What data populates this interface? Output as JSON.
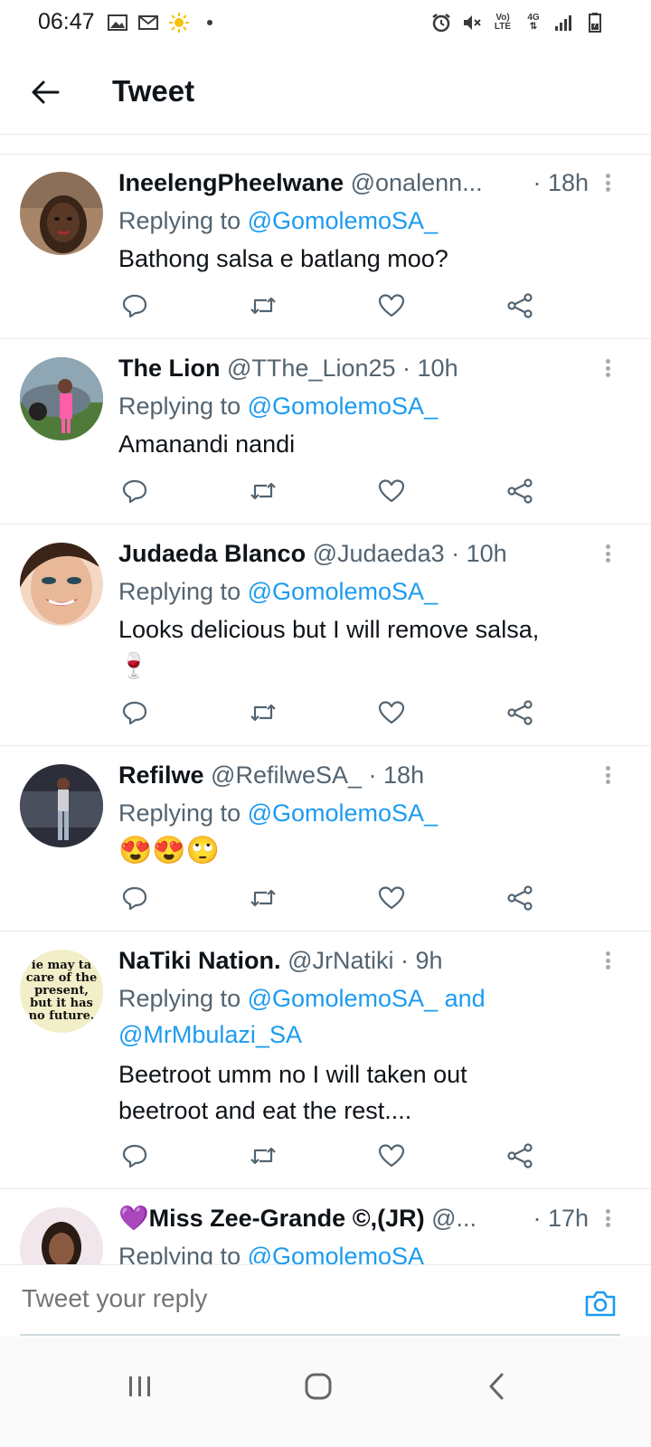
{
  "status_bar": {
    "time": "06:47",
    "left_icons": [
      "gallery-icon",
      "gmail-icon",
      "sun-icon",
      "dot-icon"
    ],
    "volte_label": "Vo) LTE",
    "network_label": "4G",
    "right_icons": [
      "alarm-icon",
      "mute-icon",
      "volte-icon",
      "4g-icon",
      "signal-icon",
      "battery-icon"
    ]
  },
  "header": {
    "back_icon": "arrow-left-icon",
    "title": "Tweet"
  },
  "tweets": [
    {
      "name": "IneelengPheelwane",
      "handle": "@onalenn...",
      "time": "· 18h",
      "reply_prefix": "Replying to ",
      "reply_to": "@GomolemoSA_",
      "body": "Bathong salsa e batlang moo?"
    },
    {
      "name": "The Lion",
      "handle": "@TThe_Lion25",
      "time": "· 10h",
      "reply_prefix": "Replying to ",
      "reply_to": "@GomolemoSA_",
      "body": "Amanandi nandi"
    },
    {
      "name": "Judaeda Blanco",
      "handle": "@Judaeda3",
      "time": "· 10h",
      "reply_prefix": "Replying to ",
      "reply_to": "@GomolemoSA_",
      "body": "Looks delicious but I will remove salsa,",
      "body2": "🍷"
    },
    {
      "name": "Refilwe",
      "handle": "@RefilweSA_",
      "time": "· 18h",
      "reply_prefix": "Replying to ",
      "reply_to": "@GomolemoSA_",
      "body": "😍😍🙄"
    },
    {
      "name": "NaTiki Nation.",
      "handle": "@JrNatiki",
      "time": "· 9h",
      "reply_prefix": "Replying to ",
      "reply_to": "@GomolemoSA_ and",
      "reply_to2": "@MrMbulazi_SA",
      "body": "Beetroot umm no I will taken out",
      "body2": "beetroot and eat the rest....",
      "avatar_text": "ie may ta care of the present, but it has no future."
    },
    {
      "name": "💜Miss Zee-Grande ©,(JR)",
      "handle": "@...",
      "time": "· 17h",
      "reply_prefix": "Replying to ",
      "reply_to": "@GomolemoSA_"
    }
  ],
  "composer": {
    "placeholder": "Tweet your reply",
    "camera_icon": "camera-icon"
  },
  "navbar": {
    "icons": [
      "recent-apps-icon",
      "home-icon",
      "back-icon"
    ]
  },
  "colors": {
    "link": "#1d9bf0",
    "secondary_text": "#536471",
    "primary_text": "#0f1419",
    "divider": "#e6ecf0"
  }
}
